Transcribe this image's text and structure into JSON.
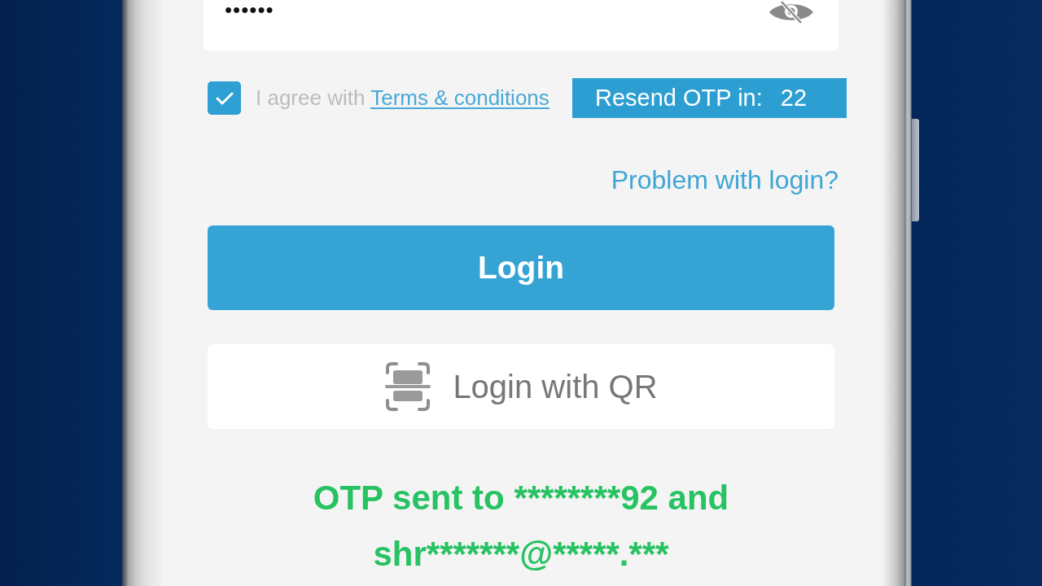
{
  "password_field": {
    "value": "••••••"
  },
  "terms": {
    "checked": true,
    "text": "I agree with",
    "link": "Terms & conditions"
  },
  "resend_toast": {
    "label": "Resend OTP in:",
    "countdown": "22"
  },
  "problem_link": "Problem with login?",
  "buttons": [
    {
      "kind": "primary",
      "label": "Login"
    },
    {
      "kind": "qr",
      "label": "Login with QR"
    }
  ],
  "otp_message": "OTP sent to ********92 and shr*******@*****.***"
}
